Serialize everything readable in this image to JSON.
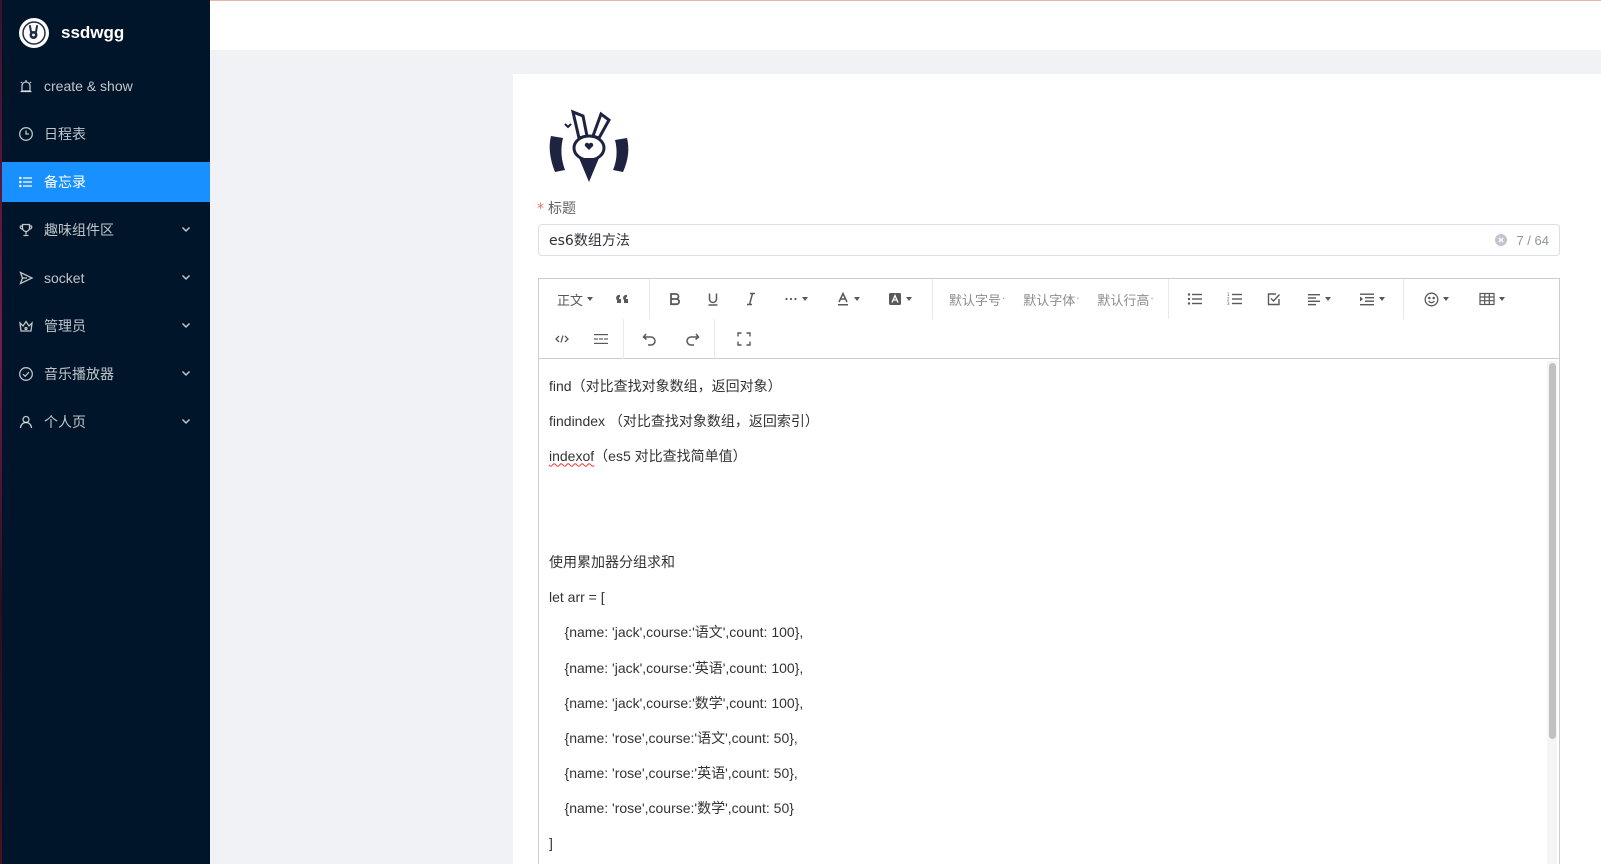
{
  "app": {
    "name": "ssdwgg"
  },
  "sidebar": {
    "items": [
      {
        "label": "create & show",
        "icon": "alarm-icon",
        "expandable": false,
        "active": false
      },
      {
        "label": "日程表",
        "icon": "clock-icon",
        "expandable": false,
        "active": false
      },
      {
        "label": "备忘录",
        "icon": "list-icon",
        "expandable": false,
        "active": true
      },
      {
        "label": "趣味组件区",
        "icon": "trophy-icon",
        "expandable": true,
        "active": false
      },
      {
        "label": "socket",
        "icon": "send-icon",
        "expandable": true,
        "active": false
      },
      {
        "label": "管理员",
        "icon": "crown-icon",
        "expandable": true,
        "active": false
      },
      {
        "label": "音乐播放器",
        "icon": "check-circle-icon",
        "expandable": true,
        "active": false
      },
      {
        "label": "个人页",
        "icon": "user-icon",
        "expandable": true,
        "active": false
      }
    ]
  },
  "form": {
    "title_label": "标题",
    "title_value": "es6数组方法",
    "title_counter": "7 / 64"
  },
  "toolbar": {
    "paragraph": "正文",
    "font_size": "默认字号",
    "font_family": "默认字体",
    "line_height": "默认行高"
  },
  "editor": {
    "lines": [
      "find（对比查找对象数组，返回对象）",
      "findindex （对比查找对象数组，返回索引）",
      "（es5 对比查找简单值）",
      "",
      "",
      "使用累加器分组求和",
      "let arr = [",
      "    {name: 'jack',course:'语文',count: 100},",
      "    {name: 'jack',course:'英语',count: 100},",
      "    {name: 'jack',course:'数学',count: 100},",
      "    {name: 'rose',course:'语文',count: 50},",
      "    {name: 'rose',course:'英语',count: 50},",
      "    {name: 'rose',course:'数学',count: 50}",
      "]"
    ],
    "misspelled_word": "indexof"
  },
  "colors": {
    "sidebar_bg": "#001529",
    "active_item": "#1890ff",
    "required_mark": "#f56c6c"
  }
}
